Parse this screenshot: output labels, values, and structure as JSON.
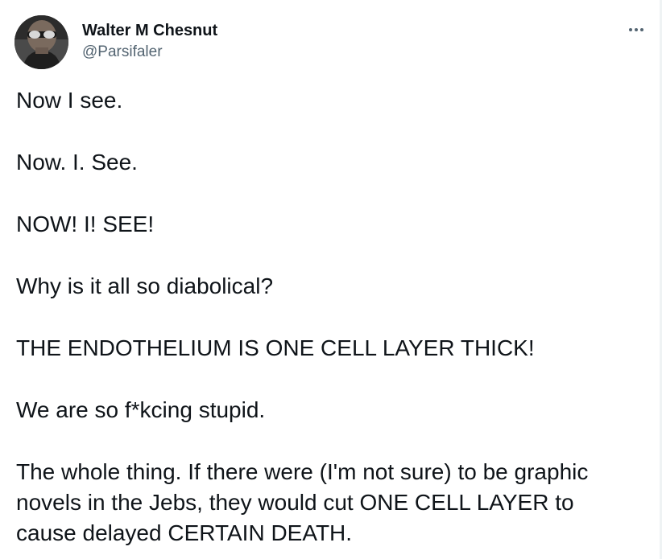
{
  "user": {
    "display_name": "Walter M Chesnut",
    "handle": "@Parsifaler",
    "avatar_icon": "profile-photo"
  },
  "more_icon": "more-options-icon",
  "tweet": {
    "paragraphs": [
      "Now I see.",
      "Now. I. See.",
      "NOW! I! SEE!",
      "Why is it all so diabolical?",
      "THE ENDOTHELIUM IS ONE CELL LAYER THICK!",
      "We are so f*kcing stupid.",
      "The whole thing. If there were (I'm not sure) to be graphic novels in the Jebs, they would cut ONE CELL LAYER to cause delayed CERTAIN DEATH."
    ]
  },
  "colors": {
    "text": "#0f1419",
    "secondary": "#536471",
    "background": "#ffffff"
  }
}
